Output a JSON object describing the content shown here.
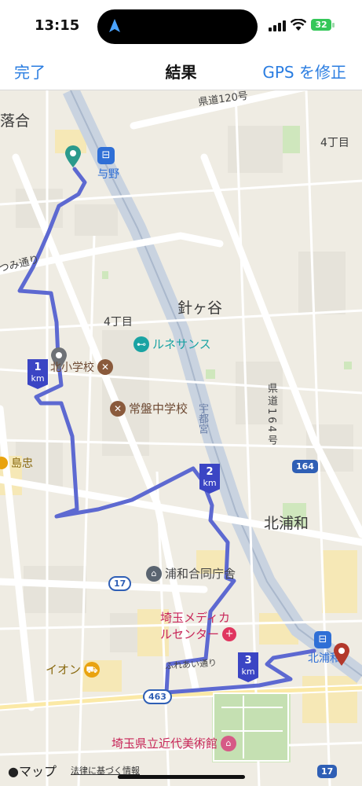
{
  "status_bar": {
    "time": "13:15",
    "battery": "32"
  },
  "nav": {
    "done_label": "完了",
    "title": "結果",
    "gps_label": "GPS を修正"
  },
  "map": {
    "areas": {
      "ochiai": "落合",
      "yono_station": "与野",
      "chome4_top": "4丁目",
      "chome4_mid": "4丁目",
      "harigaya": "針ヶ谷",
      "kitaurawa": "北浦和",
      "shimatada": "島忠"
    },
    "roads": {
      "pref_road_top": "県道120号",
      "pref_road_164": "県道164号",
      "utsunomiya": "宇都宮",
      "tsumi": "つみ通り",
      "fureai": "ふれあい通り"
    },
    "route_shields": {
      "r164": "164",
      "r17_mid": "17",
      "r463": "463",
      "r17_bottom": "17"
    },
    "pois": {
      "lunesance": "ルネサンス",
      "kita_elem": "北小学校",
      "tokiwa_jr": "常盤中学校",
      "urawa_godo": "浦和合同庁舎",
      "medical_1": "埼玉メディカ",
      "medical_2": "ルセンター",
      "aeon": "イオン",
      "kitaurawa_st": "北浦和",
      "museum": "埼玉県立近代美術館"
    },
    "km_markers": {
      "m1_num": "1",
      "m1_unit": "km",
      "m2_num": "2",
      "m2_unit": "km",
      "m3_num": "3",
      "m3_unit": "km"
    }
  },
  "footer": {
    "maps_brand": "マップ",
    "legal": "法律に基づく情報"
  },
  "colors": {
    "route": "#5d69d1",
    "accent_blue": "#2a7de1",
    "start_pin": "#2b9a8c",
    "end_pin": "#b3382b",
    "poi_teal": "#1aa3a3",
    "poi_pink": "#c8275a",
    "poi_brown": "#8a5a3c",
    "poi_gray": "#5a6470",
    "station_blue": "#2f6fd6"
  },
  "icons": {
    "location": "location-arrow-icon",
    "train": "train-icon",
    "school": "school-icon",
    "gym": "dumbbell-icon",
    "medical": "medical-cross-icon",
    "shop": "shopping-cart-icon",
    "building": "government-building-icon",
    "museum": "museum-icon",
    "apple": "apple-logo-icon"
  }
}
